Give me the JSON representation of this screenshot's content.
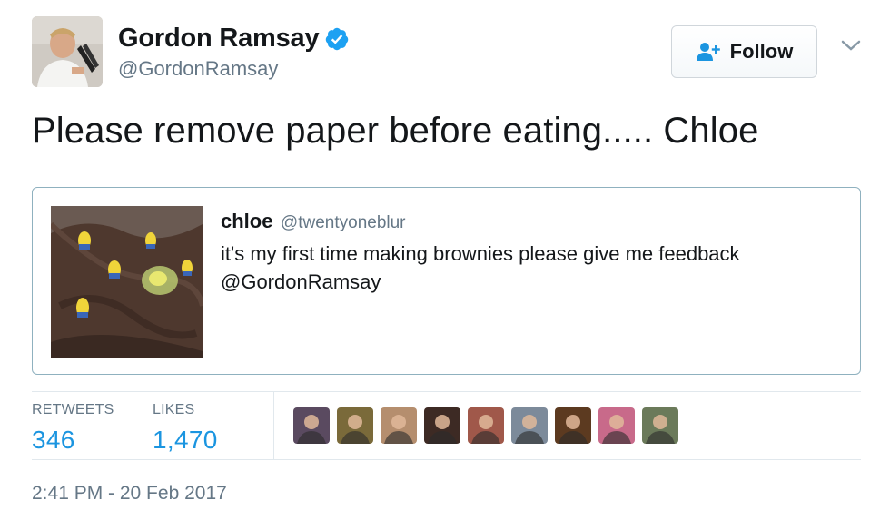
{
  "author": {
    "display_name": "Gordon Ramsay",
    "handle": "@GordonRamsay",
    "verified": true
  },
  "follow_button": {
    "label": "Follow",
    "icon": "add-user-icon"
  },
  "more_menu": {
    "icon": "chevron-down-icon"
  },
  "tweet": {
    "text": "Please remove paper before eating..... Chloe"
  },
  "quoted_tweet": {
    "name": "chloe",
    "handle": "@twentyoneblur",
    "text": "it's my first time making brownies please give me feedback @GordonRamsay"
  },
  "stats": {
    "retweets_label": "RETWEETS",
    "retweets_value": "346",
    "likes_label": "LIKES",
    "likes_value": "1,470"
  },
  "likers": [
    {
      "color": "#5a4a60"
    },
    {
      "color": "#7a6a3a"
    },
    {
      "color": "#b58e6e"
    },
    {
      "color": "#3d2a24"
    },
    {
      "color": "#a0584a"
    },
    {
      "color": "#7c8a9a"
    },
    {
      "color": "#5c3a20"
    },
    {
      "color": "#c86a8a"
    },
    {
      "color": "#6b7a5a"
    }
  ],
  "timestamp": "2:41 PM - 20 Feb 2017",
  "colors": {
    "link_blue": "#1b95e0",
    "verified_blue": "#1da1f2",
    "muted_gray": "#657786"
  }
}
